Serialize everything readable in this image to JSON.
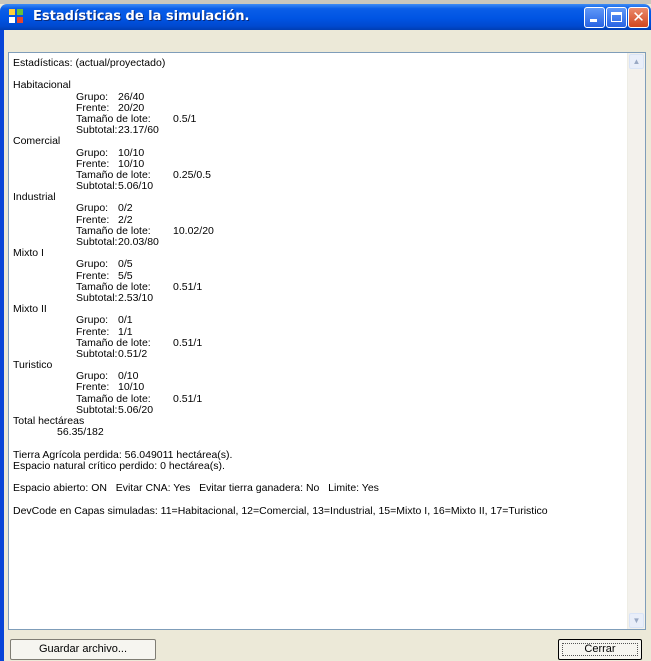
{
  "window": {
    "title": "Estadísticas de la simulación.",
    "close_glyph": "✕"
  },
  "report": {
    "header": "Estadísticas: (actual/proyectado)",
    "labels": {
      "grupo": "Grupo:",
      "frente": "Frente:",
      "tamano": "Tamaño de lote:",
      "subtotal": "Subtotal:"
    },
    "categories": [
      {
        "name": "Habitacional",
        "grupo": "26/40",
        "frente": "20/20",
        "tamano": "0.5/1",
        "subtotal": "23.17/60"
      },
      {
        "name": "Comercial",
        "grupo": "10/10",
        "frente": "10/10",
        "tamano": "0.25/0.5",
        "subtotal": "5.06/10"
      },
      {
        "name": "Industrial",
        "grupo": "0/2",
        "frente": "2/2",
        "tamano": "10.02/20",
        "subtotal": "20.03/80"
      },
      {
        "name": "Mixto I",
        "grupo": "0/5",
        "frente": "5/5",
        "tamano": "0.51/1",
        "subtotal": "2.53/10"
      },
      {
        "name": "Mixto II",
        "grupo": "0/1",
        "frente": "1/1",
        "tamano": "0.51/1",
        "subtotal": "0.51/2"
      },
      {
        "name": "Turistico",
        "grupo": "0/10",
        "frente": "10/10",
        "tamano": "0.51/1",
        "subtotal": "5.06/20"
      }
    ],
    "total_label": "Total hectáreas",
    "total_value": "56.35/182",
    "tierra_agricola": "Tierra Agrícola perdida: 56.049011 hectárea(s).",
    "espacio_natural": "Espacio natural crítico perdido: 0 hectárea(s).",
    "options_line": "Espacio abierto: ON   Evitar CNA: Yes   Evitar tierra ganadera: No   Limite: Yes",
    "devcode_line": "DevCode en Capas simuladas: 11=Habitacional, 12=Comercial, 13=Industrial, 15=Mixto I, 16=Mixto II, 17=Turistico"
  },
  "buttons": {
    "save": "Guardar archivo...",
    "close": "Cerrar"
  },
  "colors": {
    "titlebar": "#0054e3",
    "close_button": "#d2461f",
    "dialog_bg": "#ece9d8"
  }
}
